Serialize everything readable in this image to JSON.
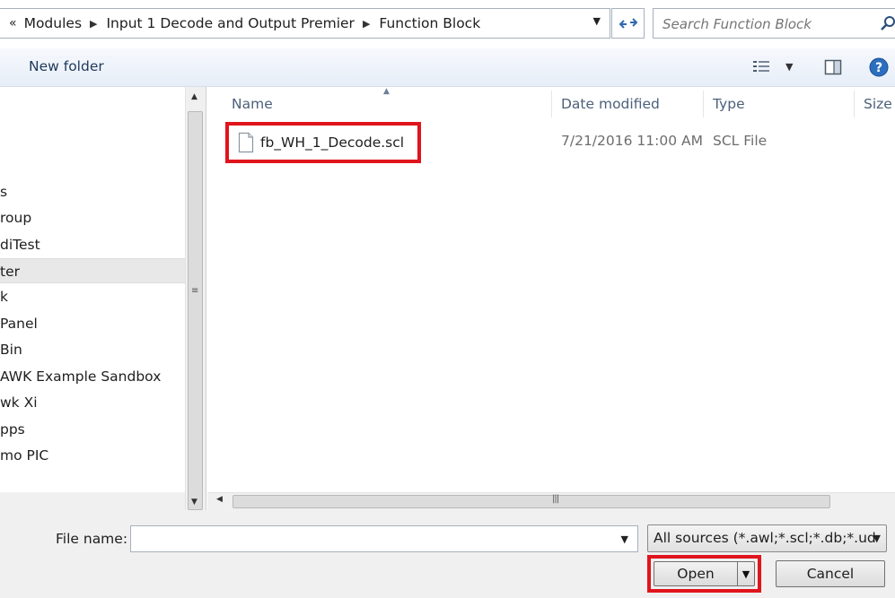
{
  "address": {
    "overflow_glyph": "«",
    "breadcrumbs": [
      "Modules",
      "Input 1 Decode and Output Premier",
      "Function Block"
    ]
  },
  "search": {
    "placeholder": "Search Function Block"
  },
  "toolbar": {
    "new_folder_label": "New folder"
  },
  "nav_pane": {
    "items": [
      "s",
      "roup",
      "diTest",
      "ter",
      "k",
      " Panel",
      " Bin",
      "AWK Example Sandbox",
      "wk Xi",
      "pps",
      "mo PIC"
    ],
    "selected_index": 3
  },
  "columns": {
    "name": "Name",
    "date_modified": "Date modified",
    "type": "Type",
    "size": "Size"
  },
  "files": [
    {
      "name": "fb_WH_1_Decode.scl",
      "date_modified": "7/21/2016 11:00 AM",
      "type": "SCL File",
      "size": ""
    }
  ],
  "footer": {
    "file_name_label": "File name:",
    "file_name_value": "",
    "filter_text": "All sources (*.awl;*.scl;*.db;*.ud",
    "open_label": "Open",
    "cancel_label": "Cancel"
  },
  "colors": {
    "highlight_red": "#e0141c",
    "toolbar_bg": "#e7eef8",
    "column_header_text": "#4c607a",
    "footer_bg": "#f0f0f0"
  },
  "icons": [
    "chevron-double-left-icon",
    "breadcrumb-arrow-icon",
    "refresh-icon",
    "search-icon",
    "views-icon",
    "preview-pane-icon",
    "help-icon",
    "document-icon",
    "dropdown-arrow-icon"
  ]
}
